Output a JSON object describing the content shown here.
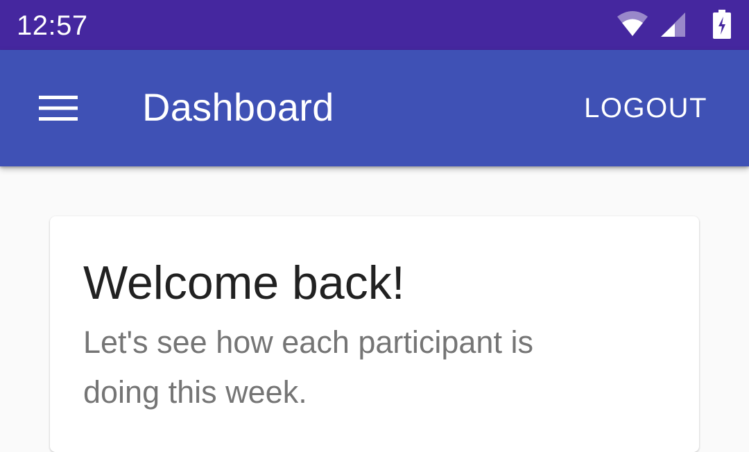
{
  "status_bar": {
    "time": "12:57",
    "icons": [
      "wifi-icon",
      "cellular-signal-icon",
      "battery-charging-icon"
    ],
    "background": "#45279f"
  },
  "app_bar": {
    "menu_icon": "hamburger-menu-icon",
    "title": "Dashboard",
    "logout_label": "LOGOUT",
    "background": "#3f51b5"
  },
  "card": {
    "title": "Welcome back!",
    "subtitle": "Let's see how each participant is doing this week."
  }
}
